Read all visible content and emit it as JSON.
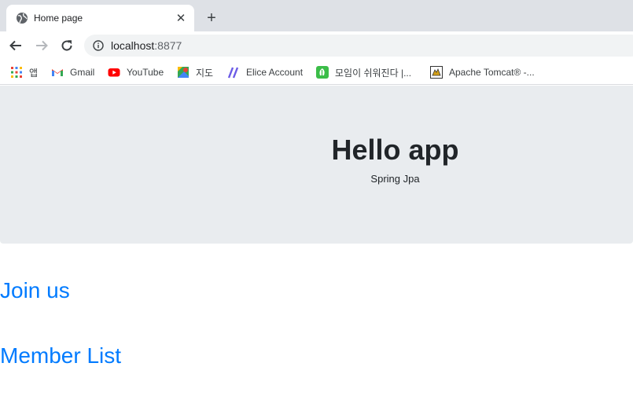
{
  "tab": {
    "title": "Home page",
    "close_glyph": "✕",
    "favicon": "globe-icon"
  },
  "new_tab_glyph": "+",
  "omnibox": {
    "host": "localhost",
    "port": ":8877"
  },
  "bookmarks": [
    {
      "label": "앱",
      "icon": "apps-grid-icon"
    },
    {
      "label": "Gmail",
      "icon": "gmail-icon"
    },
    {
      "label": "YouTube",
      "icon": "youtube-icon"
    },
    {
      "label": "지도",
      "icon": "maps-icon"
    },
    {
      "label": "Elice Account",
      "icon": "elice-icon"
    },
    {
      "label": "모임이 쉬워진다 |...",
      "icon": "green-leaf-icon"
    },
    {
      "label": "Apache Tomcat® -...",
      "icon": "tomcat-icon"
    }
  ],
  "page": {
    "title": "Hello app",
    "subtitle": "Spring Jpa",
    "links": [
      {
        "label": "Join us"
      },
      {
        "label": "Member List"
      }
    ]
  },
  "colors": {
    "tabstrip": "#dee1e6",
    "jumbotron": "#e9ecef",
    "link": "#007bff"
  }
}
